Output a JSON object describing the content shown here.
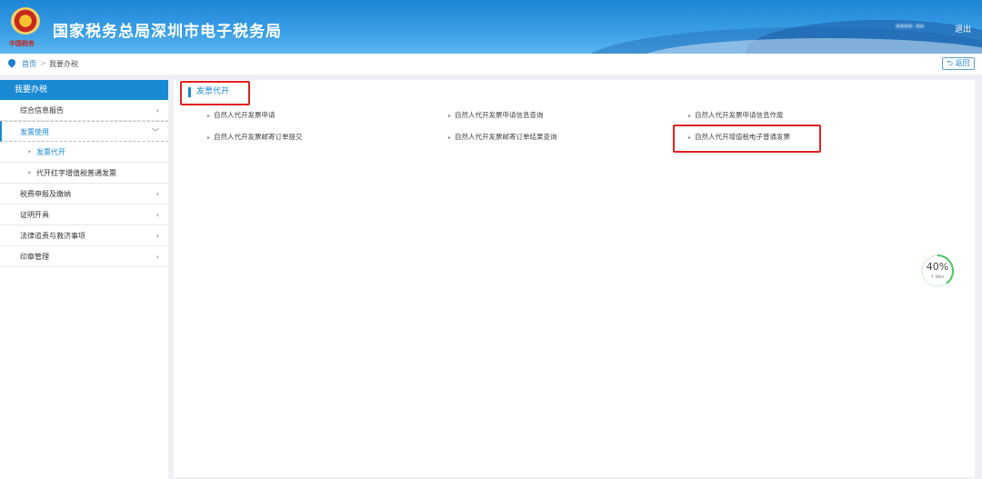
{
  "header": {
    "title": "国家税务总局深圳市电子税务局",
    "logo_text": "中国税务",
    "user": "**** **",
    "logout": "退出"
  },
  "breadcrumb": {
    "items": [
      "首页",
      "我要办税"
    ],
    "separator": ">",
    "back": "返回"
  },
  "sidebar": {
    "title": "我要办税",
    "items": [
      {
        "label": "综合信息报告",
        "chev": "›"
      },
      {
        "label": "发票使用",
        "chev": "﹀"
      },
      {
        "label": "发票代开"
      },
      {
        "label": "代开红字增值税普通发票"
      },
      {
        "label": "税费申报及缴纳",
        "chev": "›"
      },
      {
        "label": "证明开具",
        "chev": "›"
      },
      {
        "label": "法律追责与救济事项",
        "chev": "›"
      },
      {
        "label": "印章管理",
        "chev": "›"
      }
    ]
  },
  "main": {
    "section_title": "发票代开",
    "links": [
      "自然人代开发票申请",
      "自然人代开发票申请信息查询",
      "自然人代开发票申请信息作废",
      "自然人代开发票邮寄订单提交",
      "自然人代开发票邮寄订单结果查询",
      "自然人代开增值税电子普通发票"
    ]
  },
  "speed_widget": {
    "percent": "40%",
    "percent_value": 40,
    "rate": "↑ 0K/s"
  },
  "colors": {
    "primary": "#1a8ad4",
    "highlight": "#e02020"
  }
}
